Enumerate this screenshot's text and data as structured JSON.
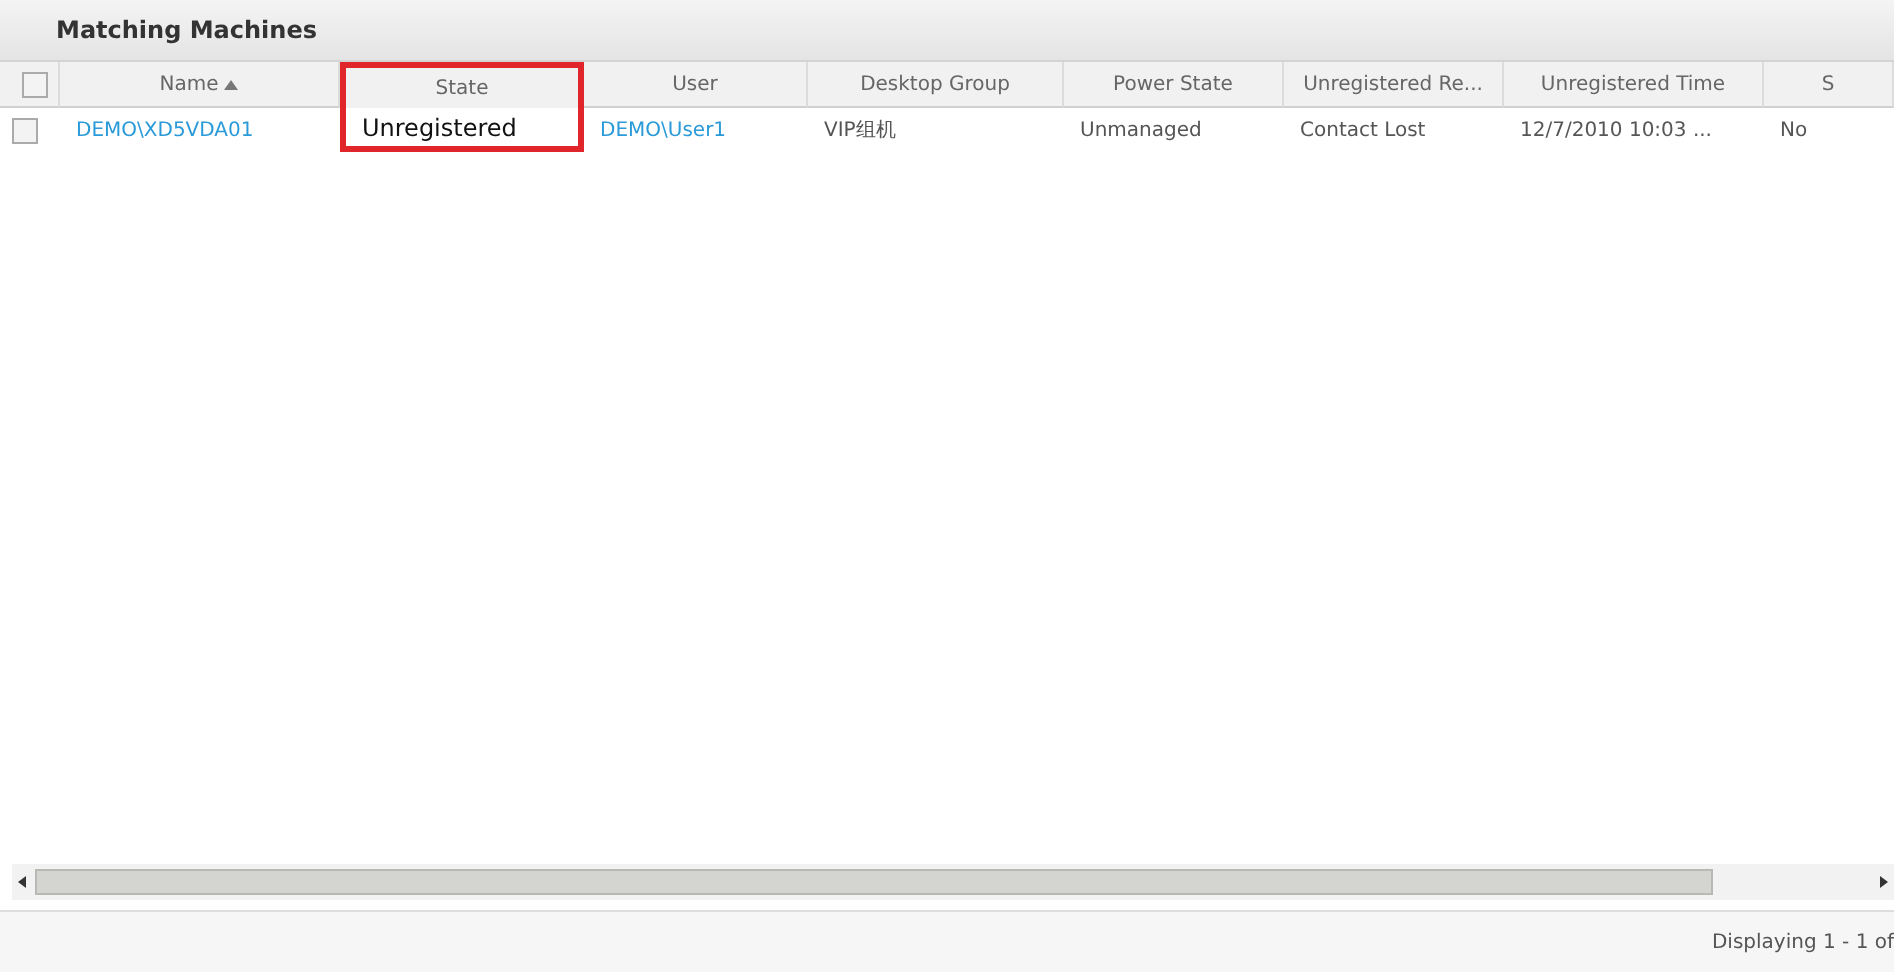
{
  "panel": {
    "title": "Matching Machines"
  },
  "table": {
    "header_checkbox": {
      "checked": false
    },
    "columns": [
      {
        "label": "Name",
        "sorted": true,
        "highlighted": false
      },
      {
        "label": "State",
        "sorted": false,
        "highlighted": true
      },
      {
        "label": "User",
        "sorted": false,
        "highlighted": false
      },
      {
        "label": "Desktop Group",
        "sorted": false,
        "highlighted": false
      },
      {
        "label": "Power State",
        "sorted": false,
        "highlighted": false
      },
      {
        "label": "Unregistered Re...",
        "sorted": false,
        "highlighted": false
      },
      {
        "label": "Unregistered Time",
        "sorted": false,
        "highlighted": false
      },
      {
        "label": "S",
        "sorted": false,
        "highlighted": false
      }
    ],
    "rows": [
      {
        "checked": false,
        "selected": false,
        "cells": [
          {
            "text": "DEMO\\XD5VDA01",
            "kind": "link"
          },
          {
            "text": "Unregistered",
            "kind": "strong"
          },
          {
            "text": "DEMO\\User1",
            "kind": "link"
          },
          {
            "text": "VIP组机",
            "kind": "text"
          },
          {
            "text": "Unmanaged",
            "kind": "text"
          },
          {
            "text": "Contact Lost",
            "kind": "text"
          },
          {
            "text": "12/7/2010 10:03 ...",
            "kind": "text"
          },
          {
            "text": "No",
            "kind": "text"
          }
        ]
      }
    ]
  },
  "status_bar": {
    "text": "Displaying 1 - 1 of"
  }
}
